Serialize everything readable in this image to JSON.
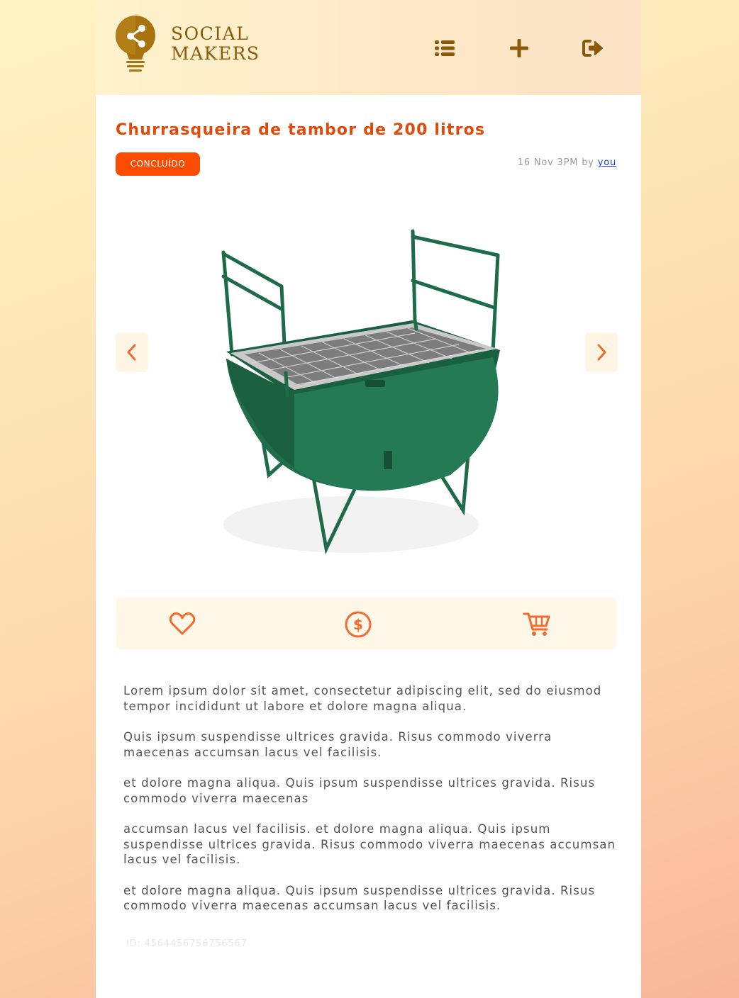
{
  "header": {
    "brand_line1": "SOCIAL",
    "brand_line2": "MAKERS",
    "logo_icon": "lightbulb-share-icon",
    "nav": [
      {
        "name": "list-icon"
      },
      {
        "name": "plus-icon"
      },
      {
        "name": "logout-icon"
      }
    ]
  },
  "post": {
    "title": "Churrasqueira de tambor de 200 litros",
    "status": "CONCLUÍDO",
    "date": "16 Nov 3PM",
    "by_label": "by",
    "author": "you",
    "id_label": "ID: 4564456756756567"
  },
  "carousel": {
    "prev_icon": "chevron-left-icon",
    "next_icon": "chevron-right-icon",
    "image_subject": "green drum barbecue grill"
  },
  "actions": [
    {
      "name": "heart-icon"
    },
    {
      "name": "dollar-coin-icon"
    },
    {
      "name": "cart-icon"
    }
  ],
  "description": [
    "Lorem ipsum dolor sit amet, consectetur adipiscing elit, sed do eiusmod tempor incididunt ut labore et dolore magna aliqua.",
    "Quis ipsum suspendisse ultrices gravida. Risus commodo viverra maecenas accumsan lacus vel facilisis.",
    "et dolore magna aliqua. Quis ipsum suspendisse ultrices gravida. Risus commodo viverra maecenas",
    "accumsan lacus vel facilisis. et dolore magna aliqua. Quis ipsum suspendisse ultrices gravida. Risus commodo viverra maecenas accumsan lacus vel facilisis.",
    "et dolore magna aliqua. Quis ipsum suspendisse ultrices gravida. Risus commodo viverra maecenas accumsan lacus vel facilisis."
  ],
  "colors": {
    "accent": "#fc4c02",
    "title": "#e04a0a",
    "brand": "#8a5a08",
    "grill_green": "#1e6b4a"
  }
}
